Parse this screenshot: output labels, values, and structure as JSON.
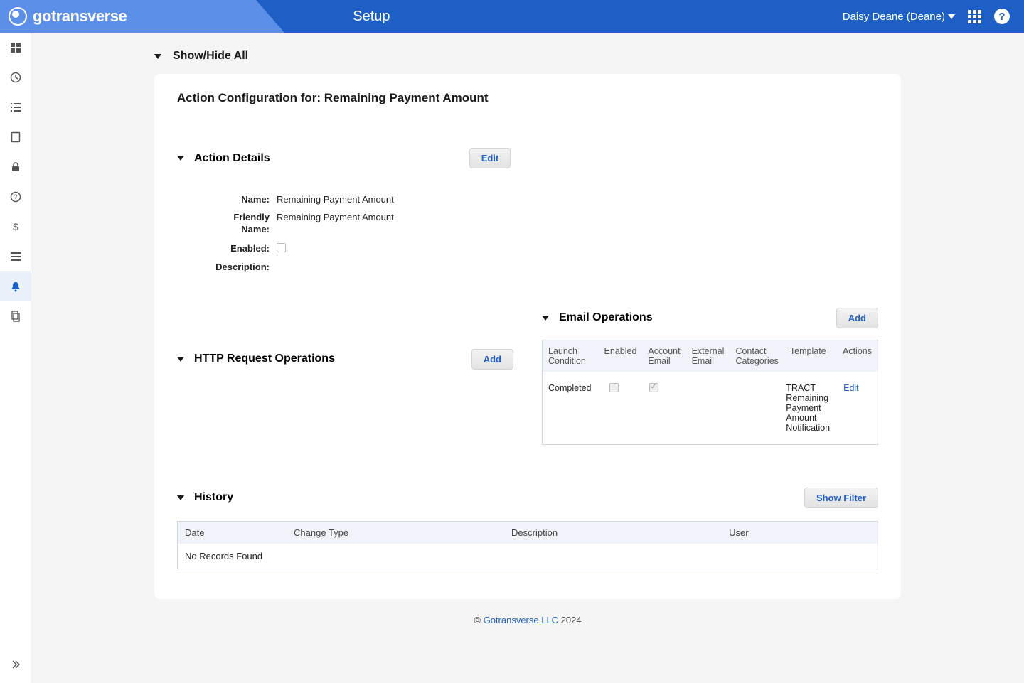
{
  "header": {
    "brand": "gotransverse",
    "title": "Setup",
    "user": "Daisy Deane (Deane)"
  },
  "page": {
    "showhide_label": "Show/Hide All",
    "card_title": "Action Configuration for: Remaining Payment Amount"
  },
  "action_details": {
    "section_title": "Action Details",
    "edit_label": "Edit",
    "fields": {
      "name_label": "Name:",
      "name_value": "Remaining Payment Amount",
      "friendly_label": "Friendly Name:",
      "friendly_value": "Remaining Payment Amount",
      "enabled_label": "Enabled:",
      "enabled_value": false,
      "description_label": "Description:",
      "description_value": ""
    }
  },
  "http_ops": {
    "section_title": "HTTP Request Operations",
    "add_label": "Add"
  },
  "email_ops": {
    "section_title": "Email Operations",
    "add_label": "Add",
    "columns": {
      "launch": "Launch Condition",
      "enabled": "Enabled",
      "account_email": "Account Email",
      "external_email": "External Email",
      "contact_cat": "Contact Categories",
      "template": "Template",
      "actions": "Actions"
    },
    "rows": [
      {
        "launch": "Completed",
        "enabled": false,
        "account_email_checked": true,
        "external_email": "",
        "contact_cat": "",
        "template": "TRACT Remaining Payment Amount Notification",
        "action": "Edit"
      }
    ]
  },
  "history": {
    "section_title": "History",
    "filter_label": "Show Filter",
    "columns": {
      "date": "Date",
      "change": "Change Type",
      "desc": "Description",
      "user": "User"
    },
    "empty": "No Records Found"
  },
  "footer": {
    "copyright": "©",
    "company": "Gotransverse LLC",
    "year": "2024"
  }
}
